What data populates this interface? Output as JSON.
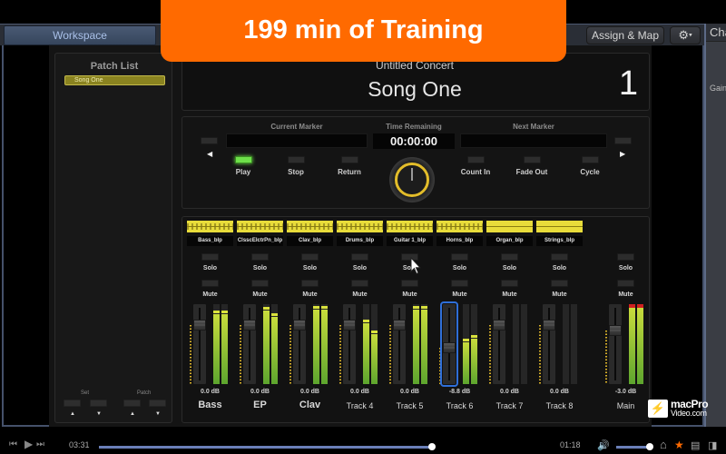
{
  "banner": {
    "text": "199 min of Training",
    "color": "#ff6a00"
  },
  "toolbar": {
    "workspace_tab": "Workspace",
    "assign_map_label": "Assign & Map",
    "gear_icon": "⚙",
    "gear_caret": "▾"
  },
  "inspector": {
    "title": "Cha",
    "gain_label": "Gain"
  },
  "patch_list": {
    "title": "Patch List",
    "items": [
      {
        "label": "Song One",
        "selected": true
      }
    ],
    "set_label": "Set",
    "patch_label": "Patch",
    "up_arrow": "▲",
    "down_arrow": "▼"
  },
  "concert": {
    "name": "Untitled Concert",
    "song": "Song One",
    "number": "1"
  },
  "transport": {
    "current_marker_label": "Current Marker",
    "time_remaining_label": "Time Remaining",
    "next_marker_label": "Next Marker",
    "time_remaining": "00:00:00",
    "prev_arrow": "◀",
    "next_arrow": "▶",
    "buttons": [
      {
        "label": "Play",
        "active": true
      },
      {
        "label": "Stop",
        "active": false
      },
      {
        "label": "Return",
        "active": false
      },
      {
        "label": "Count In",
        "active": false
      },
      {
        "label": "Fade Out",
        "active": false
      },
      {
        "label": "Cycle",
        "active": false
      }
    ]
  },
  "mixer": {
    "solo_label": "Solo",
    "mute_label": "Mute",
    "channels": [
      {
        "name": "Bass",
        "region": "Bass_blp",
        "db": "0.0 dB",
        "fader": 0.78,
        "meter_l": 0.92,
        "meter_r": 0.92,
        "has_audio": true
      },
      {
        "name": "EP",
        "region": "ClsscElctrPn_blp",
        "db": "0.0 dB",
        "fader": 0.78,
        "meter_l": 0.96,
        "meter_r": 0.88,
        "has_audio": true
      },
      {
        "name": "Clav",
        "region": "Clav_blp",
        "db": "0.0 dB",
        "fader": 0.78,
        "meter_l": 0.98,
        "meter_r": 0.98,
        "has_audio": true
      },
      {
        "name": "Track 4",
        "region": "Drums_blp",
        "db": "0.0 dB",
        "fader": 0.78,
        "meter_l": 0.8,
        "meter_r": 0.66,
        "has_audio": true
      },
      {
        "name": "Track 5",
        "region": "Guitar 1_blp",
        "db": "0.0 dB",
        "fader": 0.78,
        "meter_l": 0.98,
        "meter_r": 0.98,
        "has_audio": true
      },
      {
        "name": "Track 6",
        "region": "Horns_blp",
        "db": "-8.8 dB",
        "fader": 0.45,
        "meter_l": 0.55,
        "meter_r": 0.6,
        "has_audio": true,
        "selected": true
      },
      {
        "name": "Track 7",
        "region": "Organ_blp",
        "db": "0.0 dB",
        "fader": 0.78,
        "meter_l": 0,
        "meter_r": 0,
        "has_audio": false
      },
      {
        "name": "Track 8",
        "region": "Strings_blp",
        "db": "0.0 dB",
        "fader": 0.78,
        "meter_l": 0,
        "meter_r": 0,
        "has_audio": false
      },
      {
        "name": "Main",
        "region": "",
        "db": "-3.0 dB",
        "fader": 0.7,
        "meter_l": 1.0,
        "meter_r": 1.0,
        "has_audio": true,
        "clip": true
      }
    ]
  },
  "watermark": {
    "line1": "macPro",
    "line2": "Video.com"
  },
  "player": {
    "elapsed": "03:31",
    "remaining": "01:18",
    "progress": 0.73,
    "volume": 0.85,
    "prev_icon": "⏮",
    "play_icon": "▶",
    "next_icon": "⏭",
    "volume_icon": "🔊",
    "home_icon": "⌂",
    "star_icon": "★",
    "doc_icon": "▤",
    "sidebar_icon": "◨",
    "star_color": "#ff6a00"
  }
}
